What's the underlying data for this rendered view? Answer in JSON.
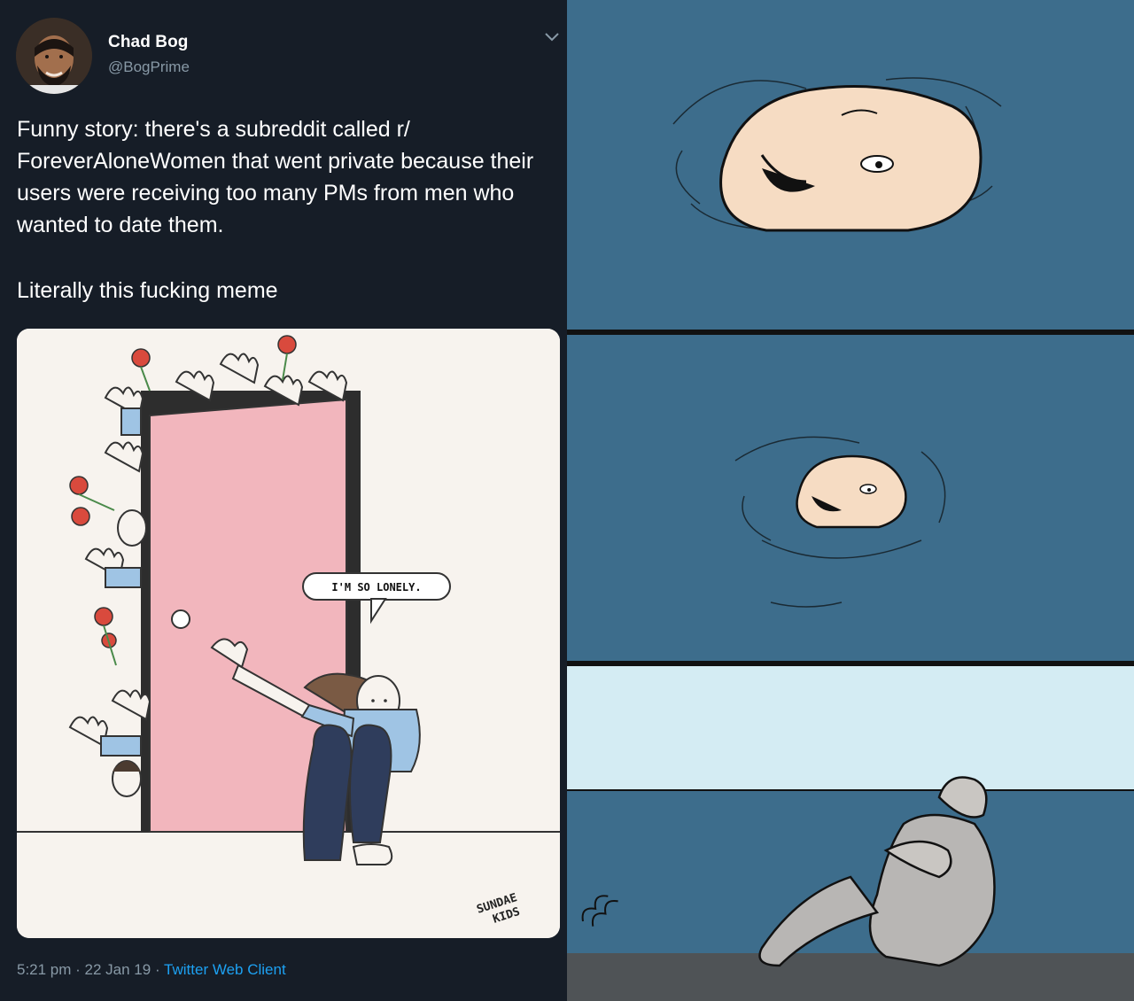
{
  "tweet": {
    "author": {
      "display_name": "Chad Bog",
      "handle": "@BogPrime"
    },
    "menu_icon": "chevron-down-icon",
    "paragraphs": [
      "Funny story: there's a subreddit called r/ ForeverAloneWomen that went private because their users were receiving too many PMs from men who wanted to date them.",
      "Literally this fucking meme"
    ],
    "media": {
      "speech_bubble": "I'M SO LONELY.",
      "signature": [
        "SUNDAE",
        "KIDS"
      ]
    },
    "meta": {
      "time": "5:21 pm",
      "sep1": " · ",
      "date": "22 Jan 19",
      "sep2": " · ",
      "client": "Twitter Web Client"
    }
  },
  "comic": {
    "panels": [
      "sinking-face-large",
      "sinking-face-small",
      "underwater-figure"
    ],
    "colors": {
      "water": "#3d6d8c",
      "sky": "#d4ecf3",
      "floor": "#4f5356"
    }
  },
  "colors": {
    "tweet_bg": "#161d27",
    "secondary_text": "#8899a6",
    "link": "#1da1f2",
    "door": "#f2b6bd",
    "flower": "#d94a3d",
    "shirt": "#9fc4e4"
  }
}
